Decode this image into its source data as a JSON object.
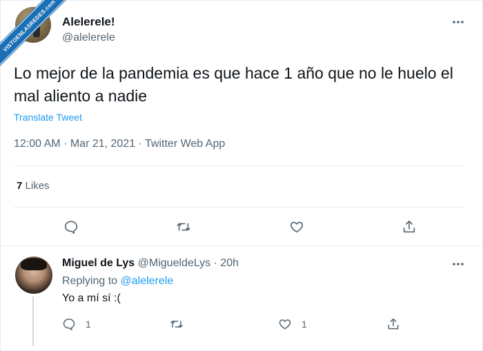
{
  "watermark": {
    "text": "VISTOENLASREDES.com"
  },
  "tweet": {
    "name": "Alelerele!",
    "handle": "@alelerele",
    "text": "Lo mejor de la pandemia es que hace 1 año que no le huelo el mal aliento a nadie",
    "translate_label": "Translate Tweet",
    "meta": "12:00 AM · Mar 21, 2021 · Twitter Web App",
    "likes_count": "7",
    "likes_label": "Likes",
    "actions": {
      "reply_icon": "reply-icon",
      "retweet_icon": "retweet-icon",
      "like_icon": "heart-icon",
      "share_icon": "share-icon"
    }
  },
  "reply": {
    "name": "Miguel de Lys",
    "handle_time": "@MigueldeLys · 20h",
    "replying_prefix": "Replying to",
    "replying_mention": "@alelerele",
    "text": "Yo a mí sí :(",
    "reply_count": "1",
    "retweet_count": "",
    "like_count": "1"
  },
  "colors": {
    "accent": "#1d9bf0",
    "text": "#0f1419",
    "muted": "#536471",
    "border": "#e6ecf0",
    "watermark": "#1b6fb5"
  }
}
